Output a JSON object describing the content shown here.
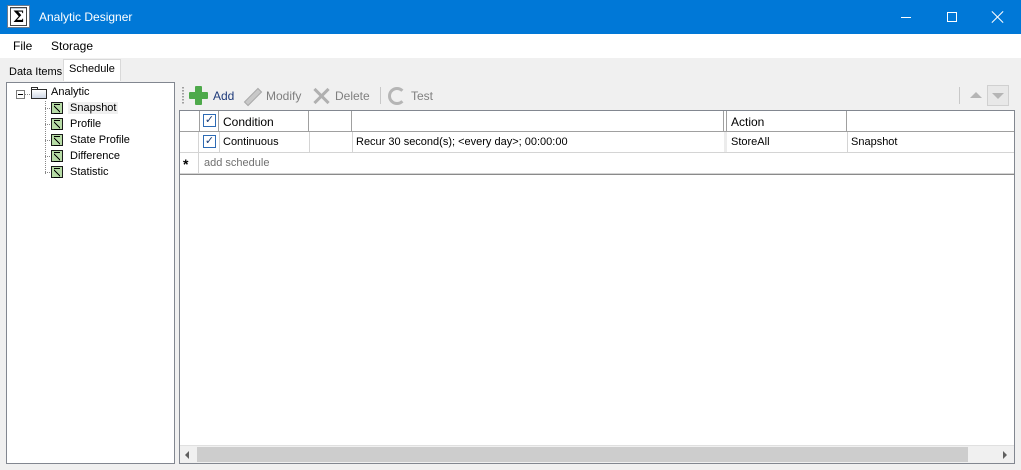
{
  "window": {
    "title": "Analytic Designer",
    "accent_color": "#0078d7"
  },
  "menu": {
    "items": [
      "File",
      "Storage"
    ]
  },
  "tabs": [
    {
      "label": "Data Items",
      "selected": false
    },
    {
      "label": "Schedule",
      "selected": true
    }
  ],
  "tree": {
    "root": "Analytic",
    "children": [
      "Snapshot",
      "Profile",
      "State Profile",
      "Difference",
      "Statistic"
    ],
    "selected": "Snapshot"
  },
  "toolbar": {
    "add_label": "Add",
    "modify_label": "Modify",
    "delete_label": "Delete",
    "test_label": "Test"
  },
  "grid": {
    "columns": [
      "Condition",
      "",
      "",
      "Action",
      ""
    ],
    "header_checked": true,
    "rows": [
      {
        "checked": true,
        "condition": "Continuous",
        "col2": "",
        "schedule": "Recur 30 second(s); <every day>; 00:00:00",
        "action": "StoreAll",
        "target": "Snapshot"
      }
    ],
    "new_row_marker": "*",
    "new_row_placeholder": "add schedule"
  }
}
